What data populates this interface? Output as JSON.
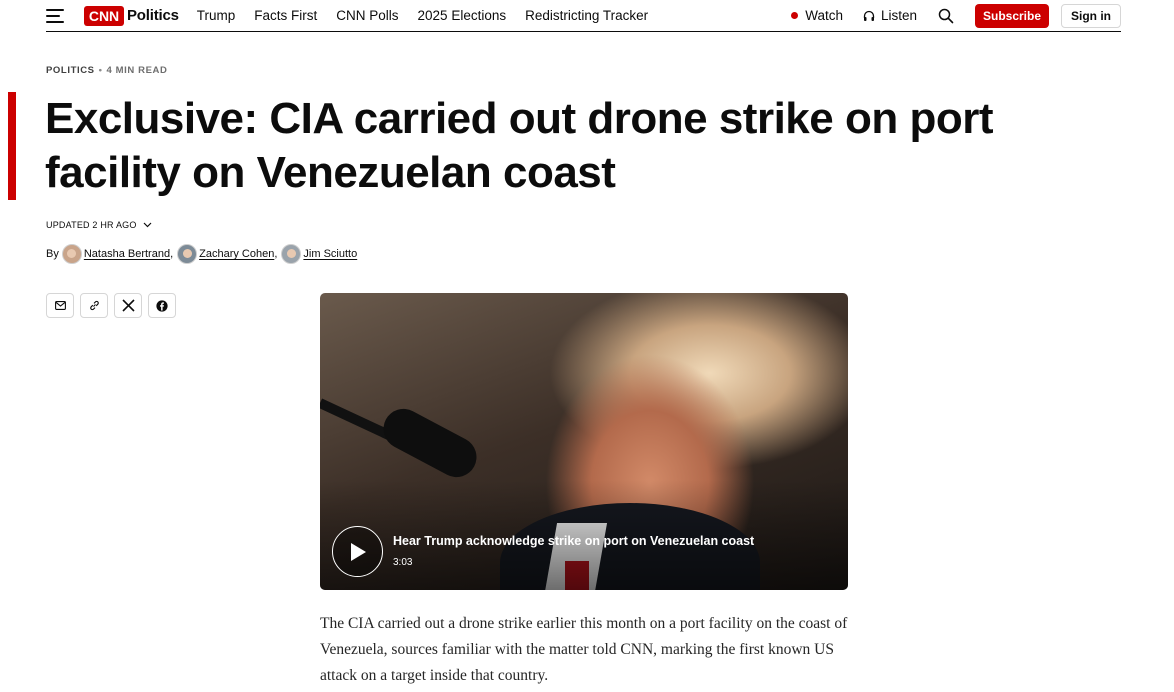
{
  "header": {
    "section": "Politics",
    "logo_text": "CNN",
    "nav": [
      "Trump",
      "Facts First",
      "CNN Polls",
      "2025 Elections",
      "Redistricting Tracker"
    ],
    "watch_label": "Watch",
    "listen_label": "Listen",
    "subscribe_label": "Subscribe",
    "signin_label": "Sign in",
    "accent_color": "#cc0000"
  },
  "article": {
    "section_label": "POLITICS",
    "read_time": "4 MIN READ",
    "headline": "Exclusive: CIA carried out drone strike on port facility on Venezuelan coast",
    "updated": "UPDATED 2 HR AGO",
    "by": "By",
    "authors": [
      "Natasha Bertrand",
      "Zachary Cohen",
      "Jim Sciutto"
    ],
    "share_icons": [
      "email-icon",
      "link-icon",
      "x-icon",
      "facebook-icon"
    ],
    "video": {
      "title": "Hear Trump acknowledge strike on port on Venezuelan coast",
      "duration": "3:03"
    },
    "body": "The CIA carried out a drone strike earlier this month on a port facility on the coast of Venezuela, sources familiar with the matter told CNN, marking the first known US attack on a target inside that country."
  }
}
